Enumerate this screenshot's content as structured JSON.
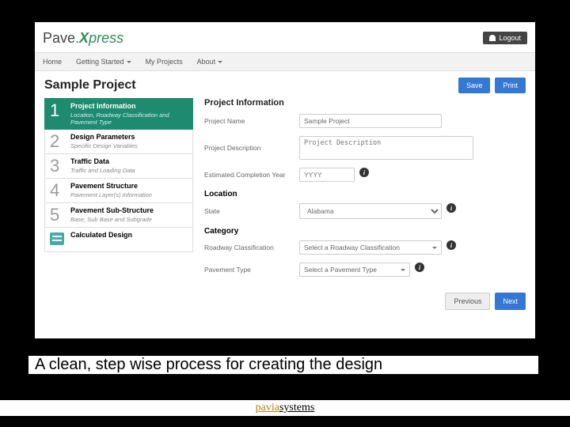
{
  "logo": {
    "part1": "Pave",
    "dot": ".",
    "part2": "X",
    "part3": "press"
  },
  "logout": "Logout",
  "nav": {
    "home": "Home",
    "getting_started": "Getting Started",
    "my_projects": "My Projects",
    "about": "About"
  },
  "page_title": "Sample Project",
  "save": "Save",
  "print": "Print",
  "steps": [
    {
      "num": "1",
      "title": "Project Information",
      "sub": "Location, Roadway Classification and Pavement Type"
    },
    {
      "num": "2",
      "title": "Design Parameters",
      "sub": "Specific Design Variables"
    },
    {
      "num": "3",
      "title": "Traffic Data",
      "sub": "Traffic and Loading Data"
    },
    {
      "num": "4",
      "title": "Pavement Structure",
      "sub": "Pavement Layer(s) Information"
    },
    {
      "num": "5",
      "title": "Pavement Sub-Structure",
      "sub": "Base, Sub Base and Subgrade"
    }
  ],
  "calc_step": "Calculated Design",
  "form": {
    "heading": "Project Information",
    "name_label": "Project Name",
    "name_value": "Sample Project",
    "desc_label": "Project Description",
    "desc_placeholder": "Project Description",
    "year_label": "Estimated Completion Year",
    "year_placeholder": "YYYY",
    "location_heading": "Location",
    "state_label": "State",
    "state_value": "Alabama",
    "category_heading": "Category",
    "roadway_label": "Roadway Classification",
    "roadway_value": "Select a Roadway Classification",
    "pavement_label": "Pavement Type",
    "pavement_value": "Select a Pavement Type"
  },
  "prev": "Previous",
  "next": "Next",
  "caption": "A clean, step wise process for creating the design",
  "footer": {
    "a": "pavia",
    "b": "systems"
  }
}
